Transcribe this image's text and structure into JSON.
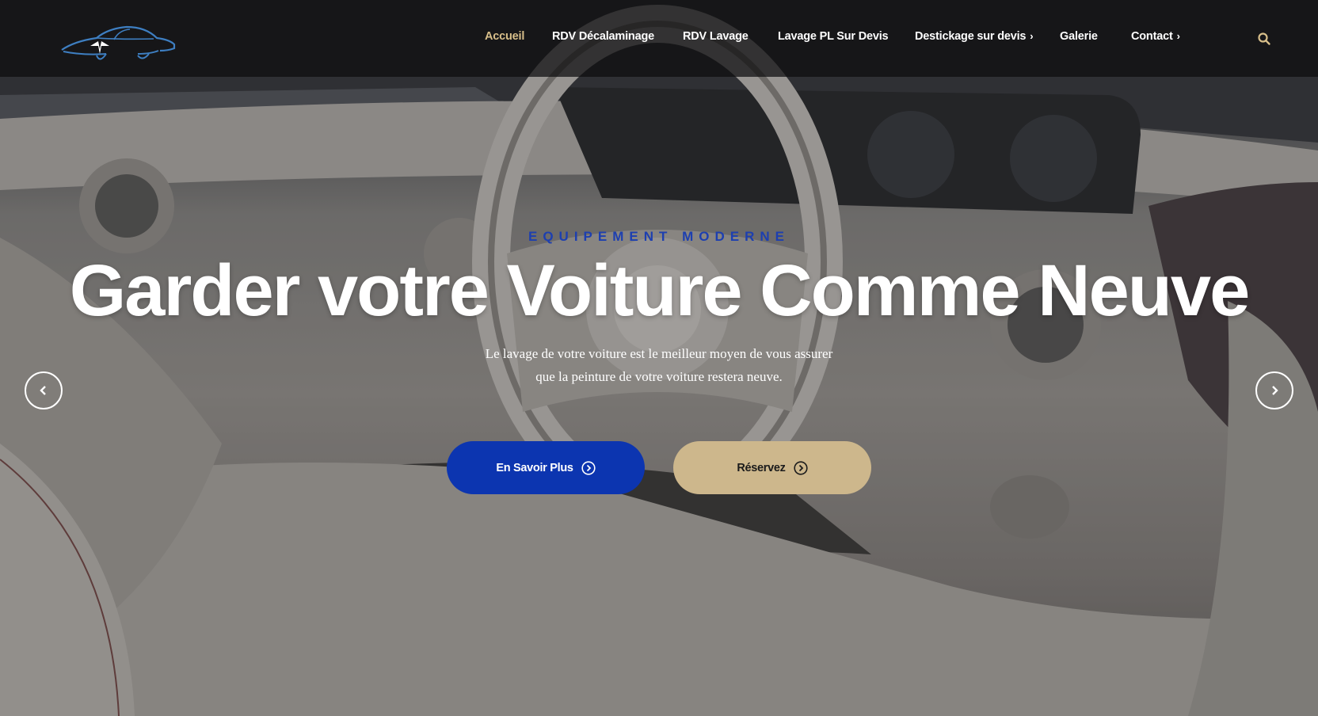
{
  "brand": {
    "logo_icon": "car-silhouette-logo"
  },
  "nav": {
    "items": [
      {
        "label": "Accueil",
        "active": true,
        "has_submenu": false
      },
      {
        "label": "RDV Décalaminage",
        "active": false,
        "has_submenu": false
      },
      {
        "label": "RDV Lavage",
        "active": false,
        "has_submenu": false
      },
      {
        "label": "Lavage PL Sur Devis",
        "active": false,
        "has_submenu": false
      },
      {
        "label": "Destickage sur devis",
        "active": false,
        "has_submenu": true
      },
      {
        "label": "Galerie",
        "active": false,
        "has_submenu": false
      },
      {
        "label": "Contact",
        "active": false,
        "has_submenu": true
      }
    ],
    "submenu_chevron": "›",
    "search_icon": "search-icon"
  },
  "hero": {
    "eyebrow": "EQUIPEMENT MODERNE",
    "title": "Garder votre Voiture Comme Neuve",
    "subtitle_line1": "Le lavage de votre voiture est le meilleur moyen de vous assurer",
    "subtitle_line2": "que la peinture de votre voiture restera neuve.",
    "primary_button": "En Savoir Plus",
    "secondary_button": "Réservez",
    "prev_icon": "chevron-left-icon",
    "next_icon": "chevron-right-icon"
  },
  "colors": {
    "accent_gold": "#d8bf8a",
    "primary_blue": "#0c35b0",
    "button_beige": "#cdb78c",
    "eyebrow_blue": "#1d3fb0"
  }
}
